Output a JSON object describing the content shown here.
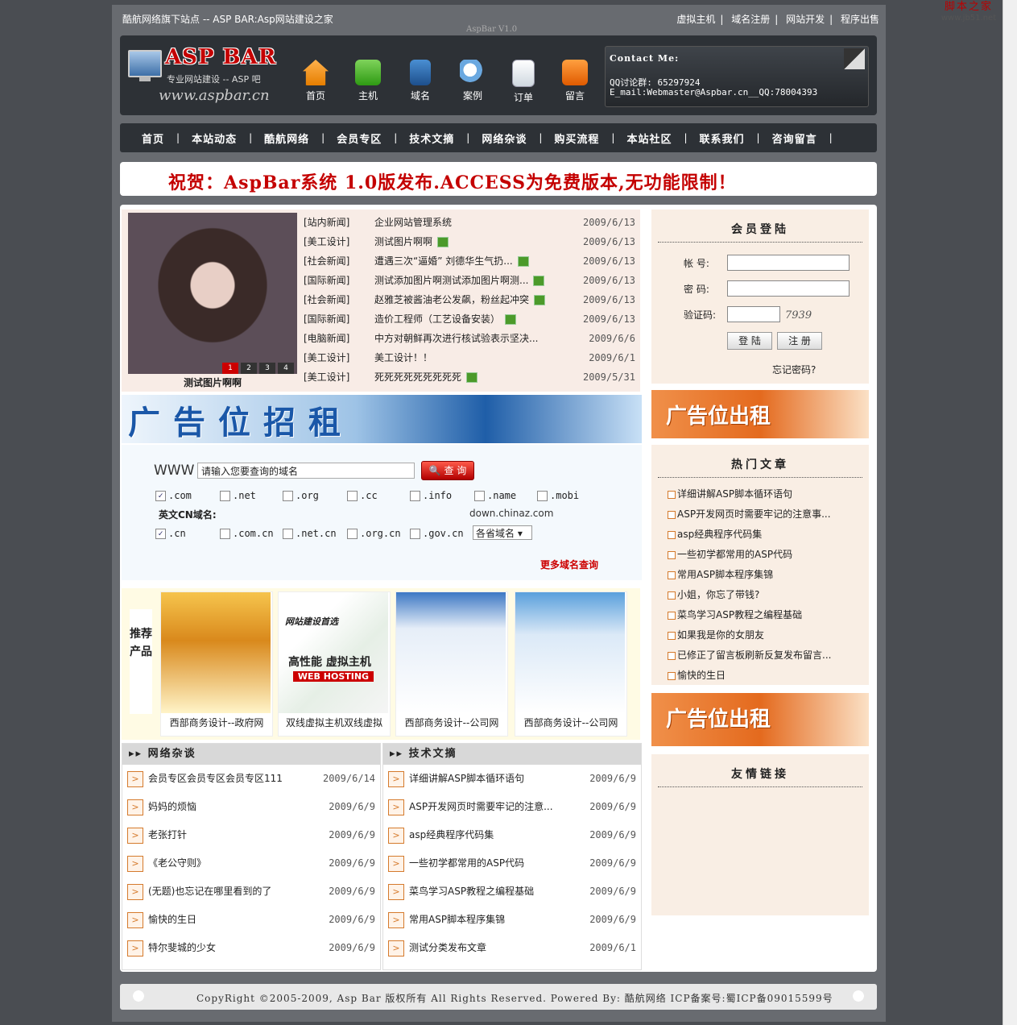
{
  "watermark": {
    "line1": "脚本之家",
    "line2": "www.jb51.net"
  },
  "top": {
    "left_text": "酷航网络旗下站点 -- ASP BAR:Asp网站建设之家",
    "links": [
      "虚拟主机",
      "域名注册",
      "网站开发",
      "程序出售"
    ],
    "version": "AspBar V1.0"
  },
  "logo": {
    "brand": "ASP BAR",
    "slogan": "专业网站建设 -- ASP 吧",
    "url": "www.aspbar.cn"
  },
  "header_nav": [
    {
      "label": "首页",
      "icon": "home-icon"
    },
    {
      "label": "主机",
      "icon": "check-icon"
    },
    {
      "label": "域名",
      "icon": "book-icon"
    },
    {
      "label": "案例",
      "icon": "magnifier-icon"
    },
    {
      "label": "订单",
      "icon": "document-icon"
    },
    {
      "label": "留言",
      "icon": "rss-icon"
    }
  ],
  "contact": {
    "title": "Contact Me:",
    "qq": "QQ讨论群: 65297924",
    "email": "E_mail:Webmaster@Aspbar.cn__QQ:78004393"
  },
  "main_nav": [
    "首页",
    "本站动态",
    "酷航网络",
    "会员专区",
    "技术文摘",
    "网络杂谈",
    "购买流程",
    "本站社区",
    "联系我们",
    "咨询留言"
  ],
  "banner": "祝贺：AspBar系统 1.0版发布.ACCESS为免费版本,无功能限制！",
  "slideshow": {
    "caption": "测试图片啊啊",
    "pages": [
      "1",
      "2",
      "3",
      "4"
    ],
    "active_page": "1"
  },
  "news": [
    {
      "cat": "[站内新闻]",
      "title": "企业网站管理系统",
      "date": "2009/6/13",
      "pic": false
    },
    {
      "cat": "[美工设计]",
      "title": "测试图片啊啊",
      "date": "2009/6/13",
      "pic": true
    },
    {
      "cat": "[社会新闻]",
      "title": "遭遇三次“逼婚” 刘德华生气扔...",
      "date": "2009/6/13",
      "pic": true
    },
    {
      "cat": "[国际新闻]",
      "title": "测试添加图片啊测试添加图片啊测...",
      "date": "2009/6/13",
      "pic": true
    },
    {
      "cat": "[社会新闻]",
      "title": "赵雅芝被酱油老公发飙，粉丝起冲突",
      "date": "2009/6/13",
      "pic": true
    },
    {
      "cat": "[国际新闻]",
      "title": "造价工程师（工艺设备安装）",
      "date": "2009/6/13",
      "pic": true
    },
    {
      "cat": "[电脑新闻]",
      "title": "中方对朝鲜再次进行核试验表示坚决...",
      "date": "2009/6/6",
      "pic": false
    },
    {
      "cat": "[美工设计]",
      "title": "美工设计！！",
      "date": "2009/6/1",
      "pic": false
    },
    {
      "cat": "[美工设计]",
      "title": "死死死死死死死死死",
      "date": "2009/5/31",
      "pic": true
    }
  ],
  "ad_banner": "广告位招租",
  "domain_search": {
    "prefix": "WWW",
    "placeholder": "请输入您要查询的域名",
    "button": "查 询",
    "tlds": [
      {
        "label": ".com",
        "checked": true
      },
      {
        "label": ".net",
        "checked": false
      },
      {
        "label": ".org",
        "checked": false
      },
      {
        "label": ".cc",
        "checked": false
      },
      {
        "label": ".info",
        "checked": false
      },
      {
        "label": ".name",
        "checked": false
      },
      {
        "label": ".mobi",
        "checked": false
      }
    ],
    "cn_label": "英文CN域名:",
    "site": "down.chinaz.com",
    "cn_tlds": [
      {
        "label": ".cn",
        "checked": true
      },
      {
        "label": ".com.cn",
        "checked": false
      },
      {
        "label": ".net.cn",
        "checked": false
      },
      {
        "label": ".org.cn",
        "checked": false
      },
      {
        "label": ".gov.cn",
        "checked": false
      }
    ],
    "province_select": "各省域名",
    "more": "更多域名查询"
  },
  "products": {
    "label": "推荐产品",
    "items": [
      {
        "name": "西部商务设计--政府网"
      },
      {
        "name": "双线虚拟主机双线虚拟"
      },
      {
        "name": "西部商务设计--公司网"
      },
      {
        "name": "西部商务设计--公司网"
      }
    ],
    "hosting_ad": {
      "line1": "网站建设首选",
      "line2": "高性能 虚拟主机",
      "line3": "WEB HOSTING"
    }
  },
  "col_left": {
    "title": "网络杂谈",
    "rows": [
      {
        "title": "会员专区会员专区会员专区111",
        "date": "2009/6/14"
      },
      {
        "title": "妈妈的烦恼",
        "date": "2009/6/9"
      },
      {
        "title": "老张打针",
        "date": "2009/6/9"
      },
      {
        "title": "《老公守则》",
        "date": "2009/6/9"
      },
      {
        "title": "(无题)也忘记在哪里看到的了",
        "date": "2009/6/9"
      },
      {
        "title": "愉快的生日",
        "date": "2009/6/9"
      },
      {
        "title": "特尔斐城的少女",
        "date": "2009/6/9"
      }
    ]
  },
  "col_right": {
    "title": "技术文摘",
    "rows": [
      {
        "title": "详细讲解ASP脚本循环语句",
        "date": "2009/6/9"
      },
      {
        "title": "ASP开发网页时需要牢记的注意...",
        "date": "2009/6/9"
      },
      {
        "title": "asp经典程序代码集",
        "date": "2009/6/9"
      },
      {
        "title": "一些初学都常用的ASP代码",
        "date": "2009/6/9"
      },
      {
        "title": "菜鸟学习ASP教程之编程基础",
        "date": "2009/6/9"
      },
      {
        "title": "常用ASP脚本程序集锦",
        "date": "2009/6/9"
      },
      {
        "title": "测试分类发布文章",
        "date": "2009/6/1"
      }
    ]
  },
  "login": {
    "title": "会员登陆",
    "account": "帐 号:",
    "password": "密 码:",
    "captcha": "验证码:",
    "captcha_code": "7939",
    "login_btn": "登 陆",
    "register_btn": "注 册",
    "forget": "忘记密码?"
  },
  "side_ad": "广告位出租",
  "hot": {
    "title": "热门文章",
    "items": [
      "详细讲解ASP脚本循环语句",
      "ASP开发网页时需要牢记的注意事...",
      "asp经典程序代码集",
      "一些初学都常用的ASP代码",
      "常用ASP脚本程序集锦",
      "小姐，你忘了带钱?",
      "菜鸟学习ASP教程之编程基础",
      "如果我是你的女朋友",
      "已修正了留言板刷新反复发布留言...",
      "愉快的生日"
    ]
  },
  "links_box": {
    "title": "友情链接"
  },
  "footer": "CopyRight ©2005-2009, Asp Bar 版权所有 All Rights Reserved. Powered By: 酷航网络  ICP备案号:蜀ICP备09015599号"
}
